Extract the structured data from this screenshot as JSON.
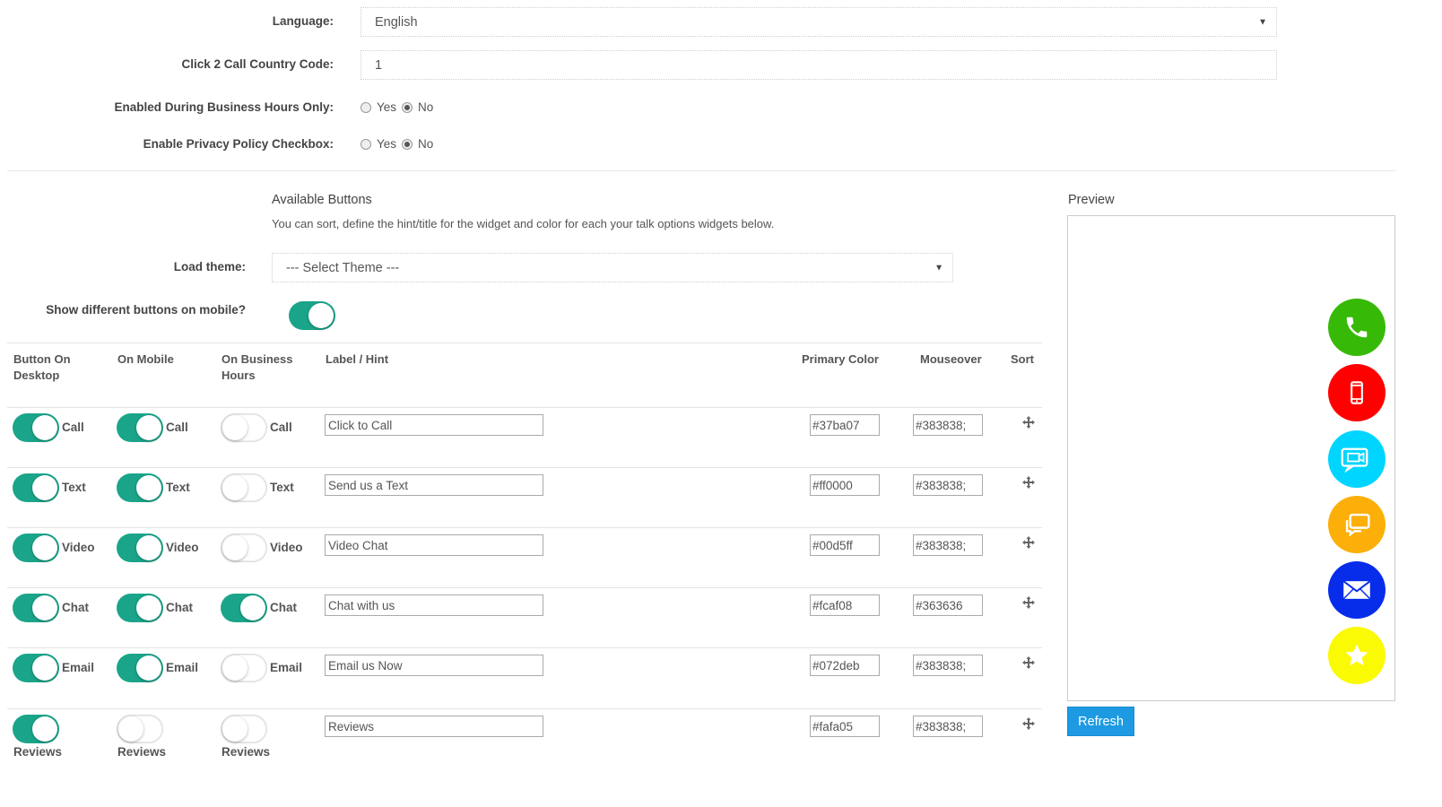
{
  "settings": {
    "language_label": "Language:",
    "language_value": "English",
    "country_code_label": "Click 2 Call Country Code:",
    "country_code_value": "1",
    "business_hours_label": "Enabled During Business Hours Only:",
    "privacy_label": "Enable Privacy Policy Checkbox:",
    "yes_label": "Yes",
    "no_label": "No",
    "business_hours_selected": "No",
    "privacy_selected": "No"
  },
  "buttons_section": {
    "title": "Available Buttons",
    "subtitle": "You can sort, define the hint/title for the widget and color for each your talk options widgets below.",
    "load_theme_label": "Load theme:",
    "load_theme_value": "--- Select Theme ---",
    "mobile_label": "Show different buttons on mobile?",
    "mobile_enabled": true
  },
  "table": {
    "headers": {
      "desktop": "Button On Desktop",
      "mobile": "On Mobile",
      "business": "On Business Hours",
      "label": "Label / Hint",
      "primary": "Primary Color",
      "mouseover": "Mouseover",
      "sort": "Sort"
    },
    "rows": [
      {
        "name": "Call",
        "desktop": true,
        "mobile": true,
        "business": false,
        "hint": "Click to Call",
        "primary": "#37ba07",
        "mouseover": "#383838;"
      },
      {
        "name": "Text",
        "desktop": true,
        "mobile": true,
        "business": false,
        "hint": "Send us a Text",
        "primary": "#ff0000",
        "mouseover": "#383838;"
      },
      {
        "name": "Video",
        "desktop": true,
        "mobile": true,
        "business": false,
        "hint": "Video Chat",
        "primary": "#00d5ff",
        "mouseover": "#383838;"
      },
      {
        "name": "Chat",
        "desktop": true,
        "mobile": true,
        "business": true,
        "hint": "Chat with us",
        "primary": "#fcaf08",
        "mouseover": "#363636"
      },
      {
        "name": "Email",
        "desktop": true,
        "mobile": true,
        "business": false,
        "hint": "Email us Now",
        "primary": "#072deb",
        "mouseover": "#383838;"
      },
      {
        "name": "Reviews",
        "desktop": true,
        "mobile": false,
        "business": false,
        "hint": "Reviews",
        "primary": "#fafa05",
        "mouseover": "#383838;"
      }
    ]
  },
  "preview": {
    "title": "Preview",
    "refresh_label": "Refresh",
    "icons": [
      {
        "icon": "phone-icon",
        "color": "#37ba07"
      },
      {
        "icon": "mobile-icon",
        "color": "#ff0000"
      },
      {
        "icon": "video-chat-icon",
        "color": "#00d5ff"
      },
      {
        "icon": "chat-icon",
        "color": "#fcaf08"
      },
      {
        "icon": "email-icon",
        "color": "#072deb"
      },
      {
        "icon": "star-icon",
        "color": "#fafa05"
      }
    ]
  }
}
